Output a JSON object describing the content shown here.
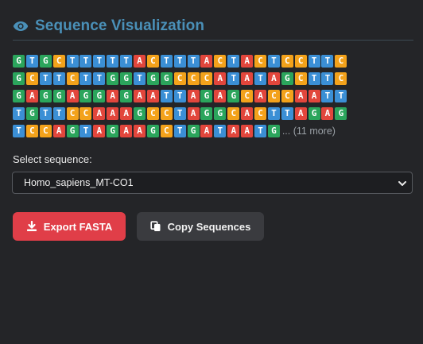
{
  "header": {
    "icon": "eye-icon",
    "title": "Sequence Visualization"
  },
  "sequences": {
    "rows": [
      [
        "G",
        "T",
        "G",
        "C",
        "T",
        "T",
        "T",
        "T",
        "T",
        "A",
        "C",
        "T",
        "T",
        "T",
        "A",
        "C",
        "T",
        "A",
        "C",
        "T",
        "C",
        "C",
        "T",
        "T",
        "C"
      ],
      [
        "G",
        "C",
        "T",
        "T",
        "C",
        "T",
        "T",
        "G",
        "G",
        "T",
        "G",
        "G",
        "C",
        "C",
        "C",
        "A",
        "T",
        "A",
        "T",
        "A",
        "G",
        "C",
        "T",
        "T",
        "C"
      ],
      [
        "G",
        "A",
        "G",
        "G",
        "A",
        "G",
        "G",
        "A",
        "G",
        "A",
        "A",
        "T",
        "T",
        "A",
        "G",
        "A",
        "G",
        "C",
        "A",
        "C",
        "C",
        "A",
        "A",
        "T",
        "T"
      ],
      [
        "T",
        "G",
        "T",
        "T",
        "C",
        "C",
        "A",
        "A",
        "A",
        "G",
        "C",
        "C",
        "T",
        "A",
        "G",
        "G",
        "C",
        "A",
        "C",
        "T",
        "T",
        "A",
        "G",
        "A",
        "G"
      ],
      [
        "T",
        "C",
        "C",
        "A",
        "G",
        "T",
        "A",
        "G",
        "A",
        "A",
        "G",
        "C",
        "T",
        "G",
        "A",
        "T",
        "A",
        "A",
        "T",
        "G"
      ]
    ],
    "more_label": "... (11 more)",
    "colors": {
      "A": "#e2463c",
      "C": "#f3a21b",
      "G": "#2ba55c",
      "T": "#3b8fd5"
    }
  },
  "select": {
    "label": "Select sequence:",
    "value": "Homo_sapiens_MT-CO1",
    "icon": "chevron-down-icon"
  },
  "buttons": {
    "export_label": "Export FASTA",
    "export_icon": "download-icon",
    "export_color": "#e03e48",
    "copy_label": "Copy Sequences",
    "copy_icon": "copy-icon"
  }
}
